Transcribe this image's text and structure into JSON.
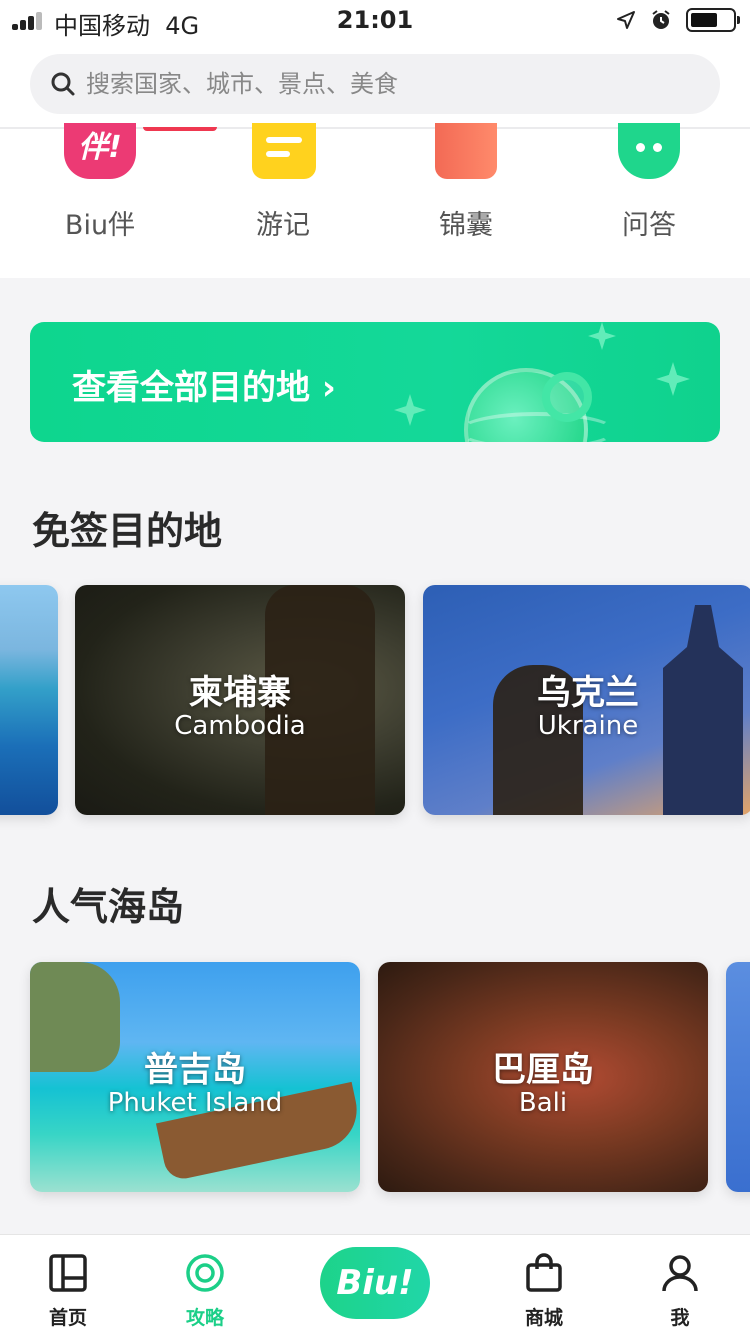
{
  "status_bar": {
    "carrier": "中国移动",
    "network": "4G",
    "time": "21:01"
  },
  "search": {
    "placeholder": "搜索国家、城市、景点、美食"
  },
  "quick_links": [
    {
      "label": "Biu伴",
      "icon": "biu-companion-icon",
      "glyph": "伴!"
    },
    {
      "label": "游记",
      "icon": "notes-icon"
    },
    {
      "label": "锦囊",
      "icon": "tips-bag-icon"
    },
    {
      "label": "问答",
      "icon": "chat-bubble-icon"
    }
  ],
  "banner": {
    "label": "查看全部目的地 ›"
  },
  "visa_free": {
    "title": "免签目的地",
    "cards": [
      {
        "name_cn": "",
        "name_en": ""
      },
      {
        "name_cn": "柬埔寨",
        "name_en": "Cambodia"
      },
      {
        "name_cn": "乌克兰",
        "name_en": "Ukraine"
      }
    ]
  },
  "islands": {
    "title": "人气海岛",
    "cards": [
      {
        "name_cn": "普吉岛",
        "name_en": "Phuket Island"
      },
      {
        "name_cn": "巴厘岛",
        "name_en": "Bali"
      }
    ]
  },
  "tabbar": {
    "home": "首页",
    "guide": "攻略",
    "center": "Biu!",
    "shop": "商城",
    "me": "我"
  },
  "colors": {
    "accent": "#1ccf88",
    "banner": "#12d691",
    "hot": "#ef3850"
  }
}
